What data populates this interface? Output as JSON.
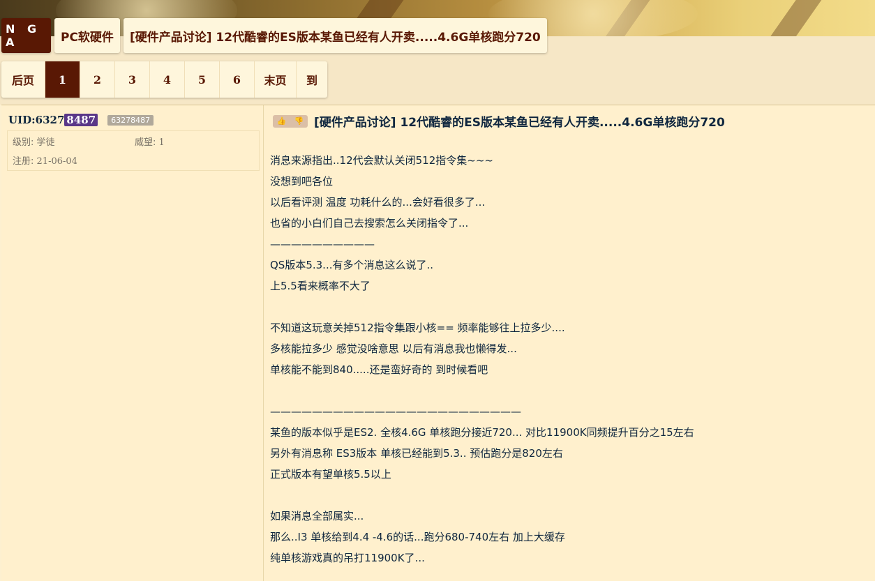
{
  "breadcrumb": {
    "logo": "N G A",
    "forum": "PC软硬件",
    "thread": "[硬件产品讨论] 12代酷睿的ES版本某鱼已经有人开卖.....4.6G单核跑分720"
  },
  "pager": {
    "prev": "后页",
    "pages": [
      "1",
      "2",
      "3",
      "4",
      "5",
      "6"
    ],
    "active": "1",
    "last": "末页",
    "goto": "到"
  },
  "user": {
    "uid_prefix": "UID:6327",
    "uid_highlight": "8487",
    "uid_badge": "63278487",
    "level_label": "级别:",
    "level_value": "学徒",
    "prestige_label": "威望:",
    "prestige_value": "1",
    "register_label": "注册:",
    "register_value": "21-06-04"
  },
  "post": {
    "vote_up": "👍",
    "vote_down": "👎",
    "title": "[硬件产品讨论] 12代酷睿的ES版本某鱼已经有人开卖.....4.6G单核跑分720",
    "lines": [
      "消息来源指出..12代会默认关闭512指令集~~~",
      "没想到吧各位",
      "以后看评测 温度 功耗什么的...会好看很多了...",
      "也省的小白们自己去搜索怎么关闭指令了...",
      "——————————",
      "QS版本5.3...有多个消息这么说了..",
      "上5.5看来概率不大了",
      "",
      "不知道这玩意关掉512指令集跟小核== 频率能够往上拉多少....",
      "多核能拉多少 感觉没啥意思 以后有消息我也懒得发...",
      "单核能不能到840.....还是蛮好奇的 到时候看吧",
      "",
      "————————————————————————",
      "某鱼的版本似乎是ES2. 全核4.6G 单核跑分接近720... 对比11900K同频提升百分之15左右",
      "另外有消息称 ES3版本 单核已经能到5.3.. 预估跑分是820左右",
      "正式版本有望单核5.5以上",
      "",
      "如果消息全部属实...",
      "那么..I3 单核给到4.4 -4.6的话...跑分680-740左右 加上大缓存",
      "纯单核游戏真的吊打11900K了..."
    ]
  },
  "colors": {
    "accent": "#591804",
    "background": "#fff0cd",
    "uid_highlight": "#5a3788"
  }
}
